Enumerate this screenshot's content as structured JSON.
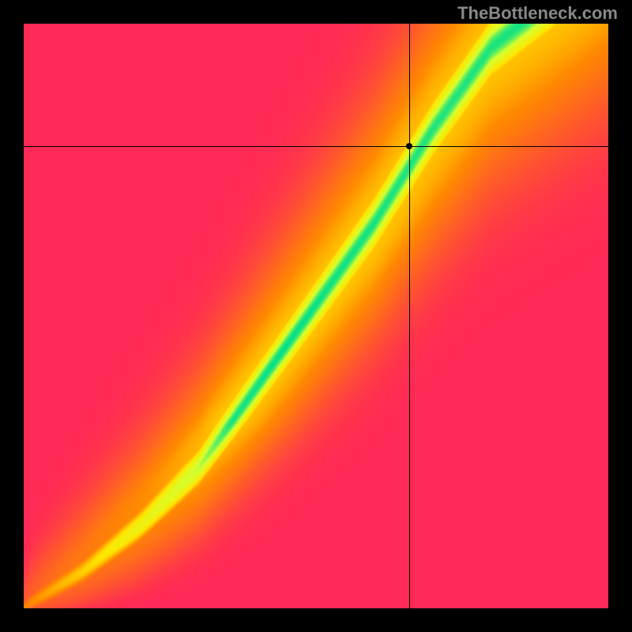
{
  "watermark": "TheBottleneck.com",
  "chart_data": {
    "type": "heatmap",
    "title": "",
    "xlabel": "",
    "ylabel": "",
    "xlim": [
      0,
      1
    ],
    "ylim": [
      0,
      1
    ],
    "grid": false,
    "legend": false,
    "crosshair": {
      "x": 0.66,
      "y": 0.79
    },
    "marker": {
      "x": 0.66,
      "y": 0.79
    },
    "color_stops": [
      {
        "value": 0.0,
        "color": "#ff2a55"
      },
      {
        "value": 0.4,
        "color": "#ff8a00"
      },
      {
        "value": 0.6,
        "color": "#ffe600"
      },
      {
        "value": 0.85,
        "color": "#d6ff2e"
      },
      {
        "value": 1.0,
        "color": "#00e08a"
      }
    ],
    "optimal_curve": [
      {
        "x": 0.0,
        "y": 0.0
      },
      {
        "x": 0.1,
        "y": 0.06
      },
      {
        "x": 0.2,
        "y": 0.14
      },
      {
        "x": 0.3,
        "y": 0.24
      },
      {
        "x": 0.4,
        "y": 0.38
      },
      {
        "x": 0.5,
        "y": 0.52
      },
      {
        "x": 0.6,
        "y": 0.66
      },
      {
        "x": 0.7,
        "y": 0.82
      },
      {
        "x": 0.8,
        "y": 0.96
      },
      {
        "x": 0.85,
        "y": 1.0
      }
    ],
    "description": "Heatmap where green band indicates optimal pairing along a superlinear curve; red indicates bottleneck. Corners: bottom-left red, top-left red, top-right yellow, bottom-right red."
  }
}
